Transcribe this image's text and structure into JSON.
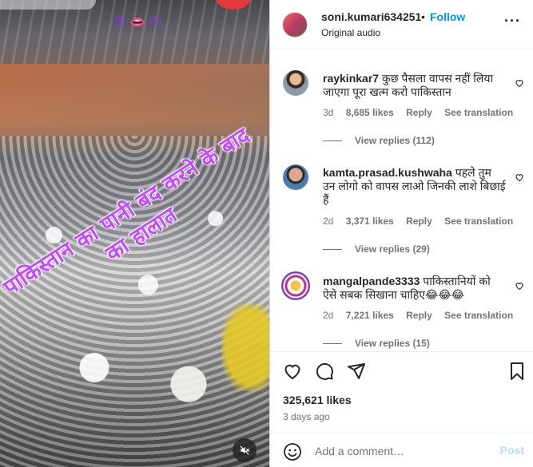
{
  "video": {
    "overlay_line1": "पाकिस्तान का पानी बंद करने के बाद",
    "overlay_line2": "का हालात",
    "eyes": "👁👄👁"
  },
  "header": {
    "username": "soni.kumari634251",
    "separator": "•",
    "follow_label": "Follow",
    "subtitle": "Original audio",
    "more": "···"
  },
  "comments": [
    {
      "username": "raykinkar7",
      "text": "कुछ पैसला वापस नहीं लिया जाएगा पूरा खत्म करो पाकिस्तान",
      "age": "3d",
      "likes": "8,685 likes",
      "reply": "Reply",
      "translate": "See translation",
      "view_replies": "View replies (112)"
    },
    {
      "username": "kamta.prasad.kushwaha",
      "text": "पहले तुम उन लोगो को वापस लाओ जिनकी लाशे बिछाई हैं",
      "age": "2d",
      "likes": "3,371 likes",
      "reply": "Reply",
      "translate": "See translation",
      "view_replies": "View replies (29)"
    },
    {
      "username": "mangalpande3333",
      "text": "पाकिस्तानियों को ऐसे सबक सिखाना चाहिए😂😂😂",
      "age": "2d",
      "likes": "7,221 likes",
      "reply": "Reply",
      "translate": "See translation",
      "view_replies": "View replies (15)"
    }
  ],
  "footer": {
    "likes": "325,621 likes",
    "time": "3 days ago",
    "comment_placeholder": "Add a comment…",
    "post_label": "Post"
  },
  "colors": {
    "accent": "#0095f6",
    "post_disabled": "#b2dffc",
    "overlay_text": "#c24bff"
  }
}
